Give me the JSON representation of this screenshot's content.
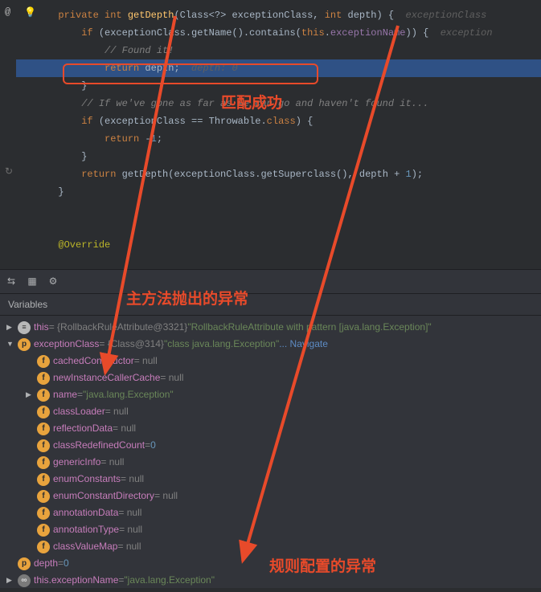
{
  "editor": {
    "gutter": {
      "at": "@",
      "bulb": "💡",
      "refresh": "↻"
    },
    "lines": {
      "l1_private": "private",
      "l1_int": "int",
      "l1_method": "getDepth",
      "l1_params": "(Class<?> exceptionClass, ",
      "l1_int2": "int",
      "l1_depth": " depth) {",
      "l1_hint": "  exceptionClass",
      "l2_if": "if",
      "l2_cond1": " (exceptionClass.getName().contains(",
      "l2_this": "this",
      "l2_cond2": ".",
      "l2_field": "exceptionName",
      "l2_cond3": ")) {",
      "l2_hint": "  exception",
      "l3_comment": "// Found it!",
      "l4_return": "return",
      "l4_val": " depth;",
      "l4_hint": "  depth: 0",
      "l5_brace": "}",
      "l6_comment": "// If we've gone as far as we can go and haven't found it...",
      "l7_if": "if",
      "l7_cond": " (exceptionClass == Throwable.",
      "l7_class": "class",
      "l7_end": ") {",
      "l8_return": "return",
      "l8_val": " -",
      "l8_num": "1",
      "l8_semi": ";",
      "l9_brace": "}",
      "l10_return": "return",
      "l10_call": " getDepth(exceptionClass.getSuperclass(), depth + ",
      "l10_num": "1",
      "l10_end": ");",
      "l11_brace": "}",
      "l12_override": "@Override"
    },
    "annotations": {
      "match_success": "匹配成功",
      "thrown_exception": "主方法抛出的异常",
      "rule_exception": "规则配置的异常"
    }
  },
  "debugger": {
    "header": "Variables",
    "vars": {
      "this_name": "this",
      "this_type": " = {RollbackRuleAttribute@3321} ",
      "this_val": "\"RollbackRuleAttribute with pattern [java.lang.Exception]\"",
      "exClass_name": "exceptionClass",
      "exClass_type": " = {Class@314} ",
      "exClass_val": "\"class java.lang.Exception\"",
      "exClass_nav": " ... Navigate",
      "cachedCtor_name": "cachedConstructor",
      "cachedCtor_val": " = null",
      "newInst_name": "newInstanceCallerCache",
      "newInst_val": " = null",
      "name_name": "name",
      "name_eq": " = ",
      "name_val": "\"java.lang.Exception\"",
      "classLoader_name": "classLoader",
      "classLoader_val": " = null",
      "reflData_name": "reflectionData",
      "reflData_val": " = null",
      "classRedef_name": "classRedefinedCount",
      "classRedef_eq": " = ",
      "classRedef_val": "0",
      "generic_name": "genericInfo",
      "generic_val": " = null",
      "enumConst_name": "enumConstants",
      "enumConst_val": " = null",
      "enumDir_name": "enumConstantDirectory",
      "enumDir_val": " = null",
      "annoData_name": "annotationData",
      "annoData_val": " = null",
      "annoType_name": "annotationType",
      "annoType_val": " = null",
      "classValMap_name": "classValueMap",
      "classValMap_val": " = null",
      "depth_name": "depth",
      "depth_eq": " = ",
      "depth_val": "0",
      "thisExName_name": "this.exceptionName",
      "thisExName_eq": " = ",
      "thisExName_val": "\"java.lang.Exception\""
    }
  }
}
